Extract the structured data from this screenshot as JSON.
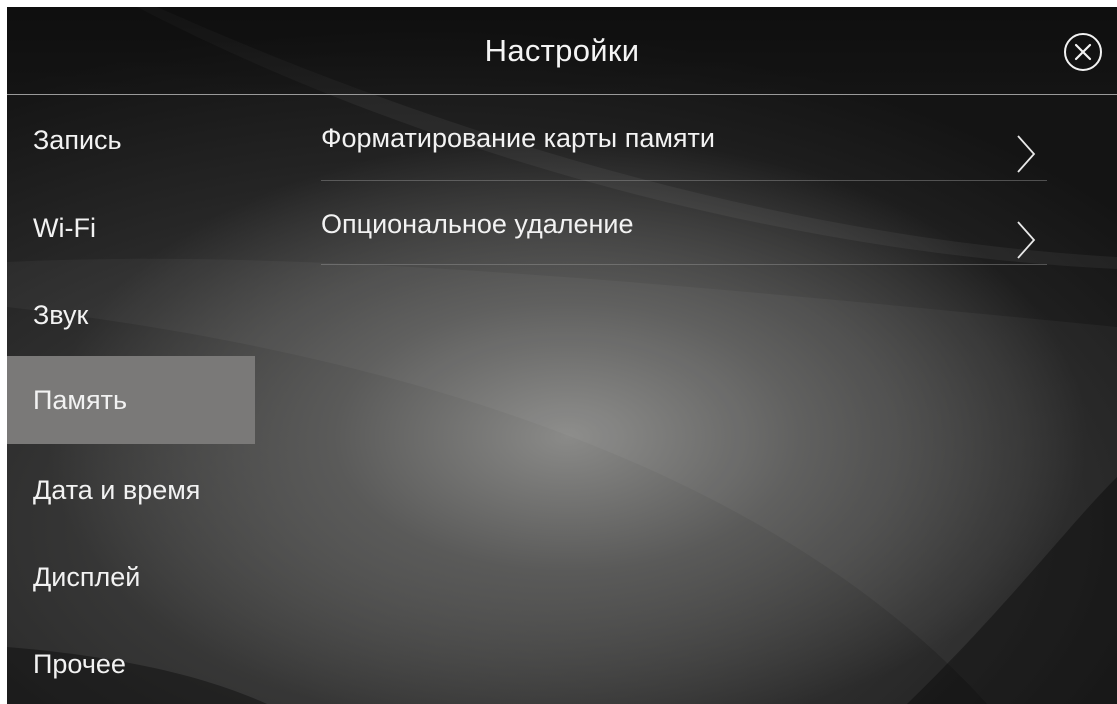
{
  "header": {
    "title": "Настройки",
    "close_icon": "close-circle-icon"
  },
  "sidebar": {
    "selected_index": 3,
    "items": [
      {
        "label": "Запись"
      },
      {
        "label": "Wi-Fi"
      },
      {
        "label": "Звук"
      },
      {
        "label": "Память"
      },
      {
        "label": "Дата и время"
      },
      {
        "label": "Дисплей"
      },
      {
        "label": "Прочее"
      }
    ]
  },
  "content": {
    "rows": [
      {
        "label": "Форматирование карты памяти",
        "icon": "chevron-right-icon"
      },
      {
        "label": "Опциональное удаление",
        "icon": "chevron-right-icon"
      }
    ]
  },
  "colors": {
    "active_item_bg": "#7a7978",
    "text": "#f2f2f2",
    "divider": "#9a9a9a"
  }
}
